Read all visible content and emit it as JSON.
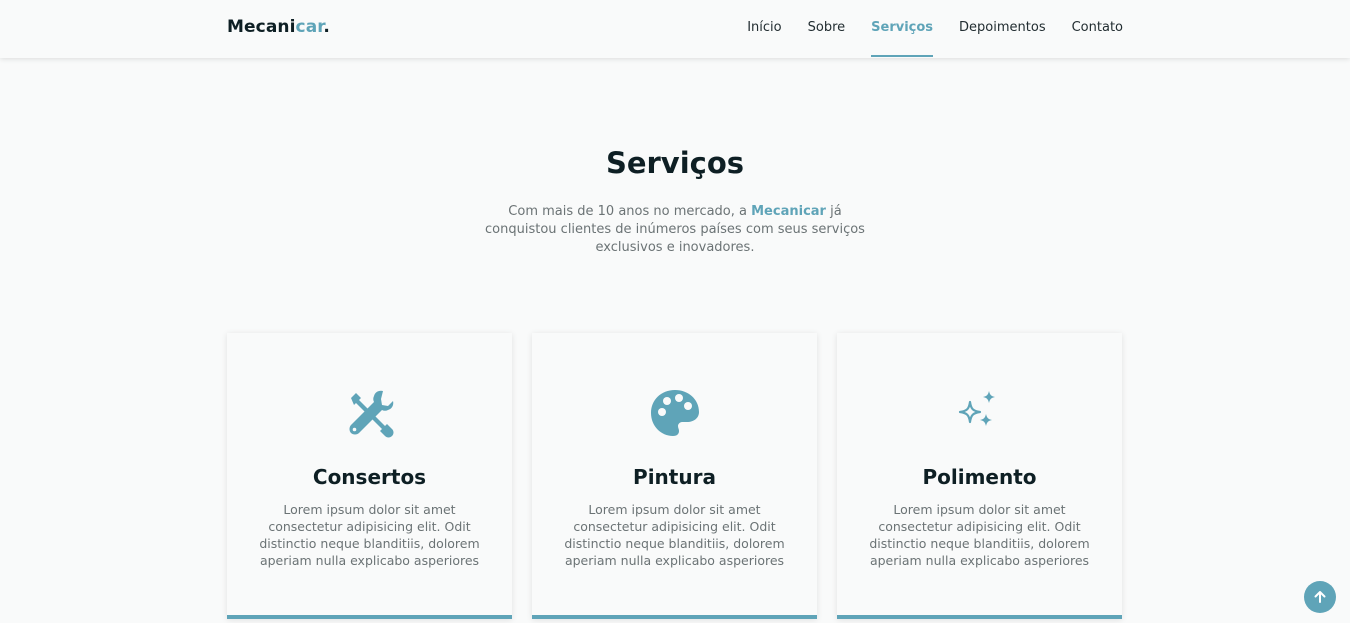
{
  "brand": {
    "name_main": "Mecani",
    "name_accent": "car",
    "name_dot": "."
  },
  "nav": {
    "items": [
      {
        "label": "Início"
      },
      {
        "label": "Sobre"
      },
      {
        "label": "Serviços",
        "active": true
      },
      {
        "label": "Depoimentos"
      },
      {
        "label": "Contato"
      }
    ]
  },
  "section": {
    "title": "Serviços",
    "subtitle_before": "Com mais de 10 anos no mercado, a ",
    "subtitle_brand": "Mecanicar",
    "subtitle_after": " já conquistou clientes de inúmeros países com seus serviços exclusivos e inovadores."
  },
  "services": [
    {
      "icon": "tools-icon",
      "title": "Consertos",
      "text": "Lorem ipsum dolor sit amet consectetur adipisicing elit. Odit distinctio neque blanditiis, dolorem aperiam nulla explicabo asperiores"
    },
    {
      "icon": "palette-icon",
      "title": "Pintura",
      "text": "Lorem ipsum dolor sit amet consectetur adipisicing elit. Odit distinctio neque blanditiis, dolorem aperiam nulla explicabo asperiores"
    },
    {
      "icon": "sparkles-icon",
      "title": "Polimento",
      "text": "Lorem ipsum dolor sit amet consectetur adipisicing elit. Odit distinctio neque blanditiis, dolorem aperiam nulla explicabo asperiores"
    }
  ],
  "colors": {
    "accent": "#5fa4b8",
    "text_dark": "#0e1f24",
    "text_muted": "#6b7375",
    "background": "#f9fafa"
  }
}
